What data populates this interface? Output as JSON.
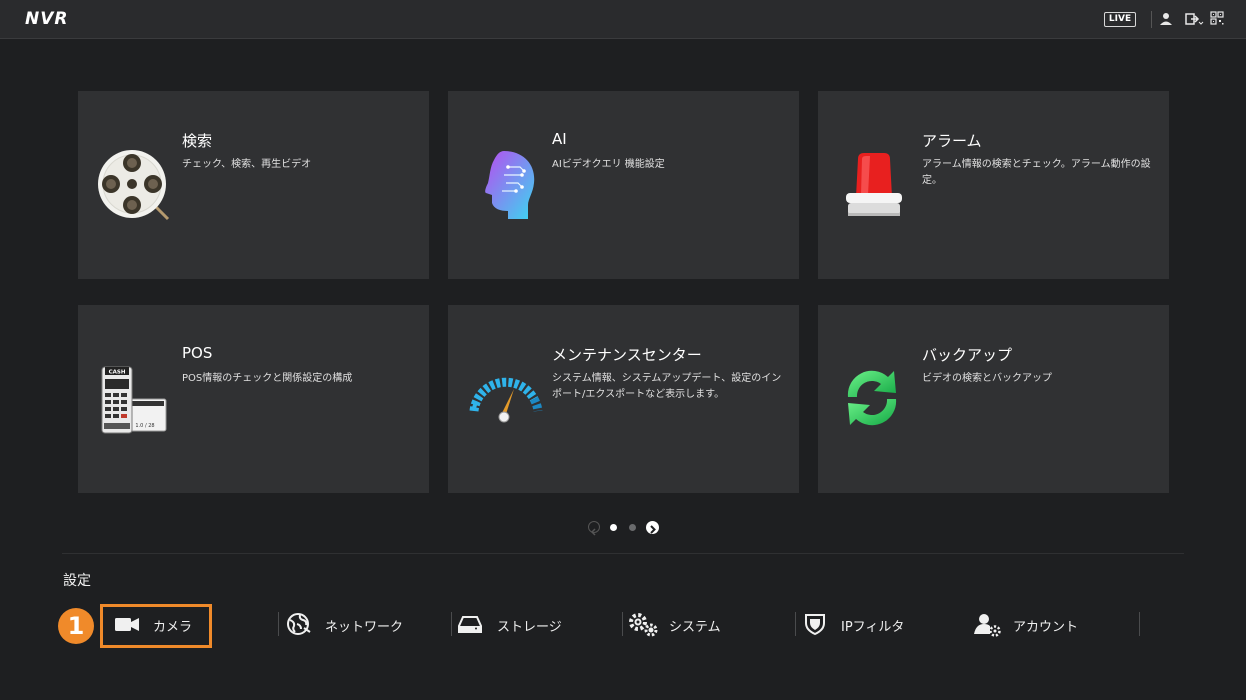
{
  "header": {
    "logo_text": "NVR",
    "live_label": "LIVE",
    "icons": [
      "user-icon",
      "logout-icon",
      "qr-code-icon"
    ]
  },
  "cards": [
    {
      "title": "検索",
      "description": "チェック、検索、再生ビデオ",
      "icon": "film-reel-icon"
    },
    {
      "title": "AI",
      "description": "AIビデオクエリ 機能設定",
      "icon": "ai-head-icon"
    },
    {
      "title": "アラーム",
      "description": "アラーム情報の検索とチェック。アラーム動作の設定。",
      "icon": "alarm-light-icon"
    },
    {
      "title": "POS",
      "description": "POS情報のチェックと関係設定の構成",
      "icon": "pos-terminal-icon"
    },
    {
      "title": "メンテナンスセンター",
      "description": "システム情報、システムアップデート、設定のインポート/エクスポートなど表示します。",
      "icon": "gauge-icon"
    },
    {
      "title": "バックアップ",
      "description": "ビデオの検索とバックアップ",
      "icon": "sync-arrows-icon"
    }
  ],
  "pager": {
    "current_page": 1,
    "total_pages": 2
  },
  "settings": {
    "title": "設定",
    "items": [
      {
        "label": "カメラ",
        "icon": "camera-icon"
      },
      {
        "label": "ネットワーク",
        "icon": "globe-icon"
      },
      {
        "label": "ストレージ",
        "icon": "storage-icon"
      },
      {
        "label": "システム",
        "icon": "gears-icon"
      },
      {
        "label": "IPフィルタ",
        "icon": "shield-icon"
      },
      {
        "label": "アカウント",
        "icon": "account-gear-icon"
      }
    ]
  },
  "annotation": {
    "step_number": "1",
    "color": "#f08a2a"
  }
}
